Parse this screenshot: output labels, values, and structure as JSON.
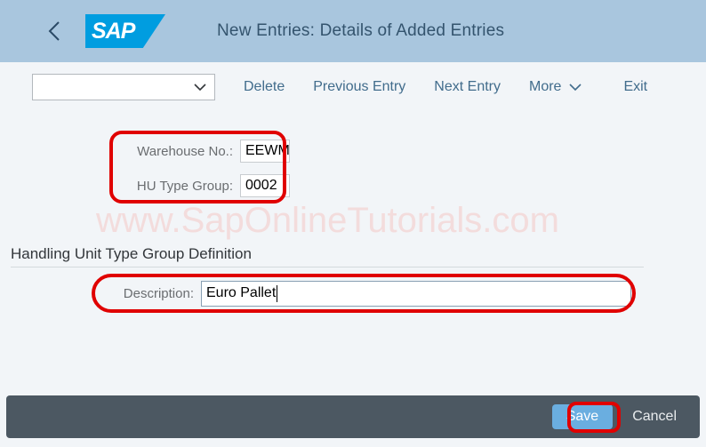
{
  "header": {
    "back_icon": "chevron-left-icon",
    "logo_text": "SAP",
    "title": "New Entries: Details of Added Entries"
  },
  "toolbar": {
    "select_value": "",
    "select_placeholder": "",
    "select_icon": "chevron-down-icon",
    "delete_label": "Delete",
    "previous_entry_label": "Previous Entry",
    "next_entry_label": "Next Entry",
    "more_label": "More",
    "more_icon": "chevron-down-icon",
    "exit_label": "Exit"
  },
  "form": {
    "warehouse_label": "Warehouse No.:",
    "warehouse_value": "EEWM",
    "hu_type_group_label": "HU Type Group:",
    "hu_type_group_value": "0002",
    "section_title": "Handling Unit Type Group Definition",
    "description_label": "Description:",
    "description_value": "Euro Pallet"
  },
  "watermark": {
    "text": "www.SapOnlineTutorials.com"
  },
  "footer": {
    "save_label": "Save",
    "cancel_label": "Cancel"
  },
  "colors": {
    "header_bg": "#a9c6de",
    "page_bg": "#f2f5f8",
    "sap_blue": "#009de0",
    "link_blue": "#416c8c",
    "footer_bg": "#4c5862",
    "save_blue": "#6aaee0",
    "annotation_red": "#e00000",
    "watermark_pink": "#f3dcdc"
  }
}
